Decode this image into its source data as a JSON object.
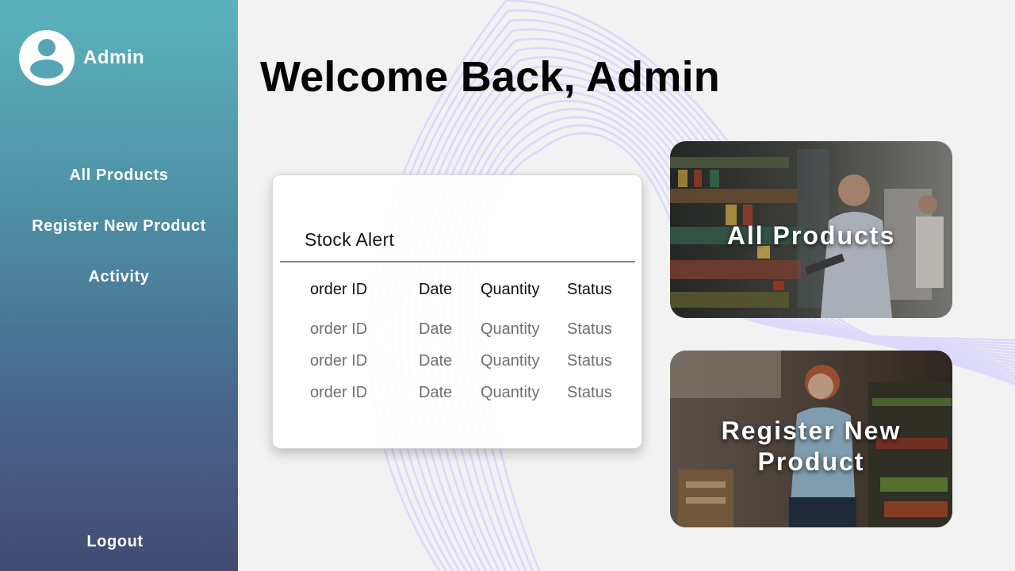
{
  "sidebar": {
    "user_name": "Admin",
    "nav": [
      {
        "label": "All Products"
      },
      {
        "label": "Register New Product"
      },
      {
        "label": "Activity"
      }
    ],
    "logout_label": "Logout"
  },
  "main": {
    "title": "Welcome Back, Admin",
    "stock_alert": {
      "title": "Stock Alert",
      "columns": [
        "order ID",
        "Date",
        "Quantity",
        "Status"
      ],
      "rows": [
        [
          "order ID",
          "Date",
          "Quantity",
          "Status"
        ],
        [
          "order ID",
          "Date",
          "Quantity",
          "Status"
        ],
        [
          "order ID",
          "Date",
          "Quantity",
          "Status"
        ]
      ]
    },
    "tiles": [
      {
        "label": "All Products",
        "icon": "grocery-aisle-photo"
      },
      {
        "label": "Register New Product",
        "icon": "grocery-shelf-photo"
      }
    ]
  },
  "colors": {
    "sidebar_top": "#5bb3bd",
    "sidebar_bottom": "#434a72",
    "background": "#f2f2f2",
    "wave_lines": "#dcd9fb"
  }
}
